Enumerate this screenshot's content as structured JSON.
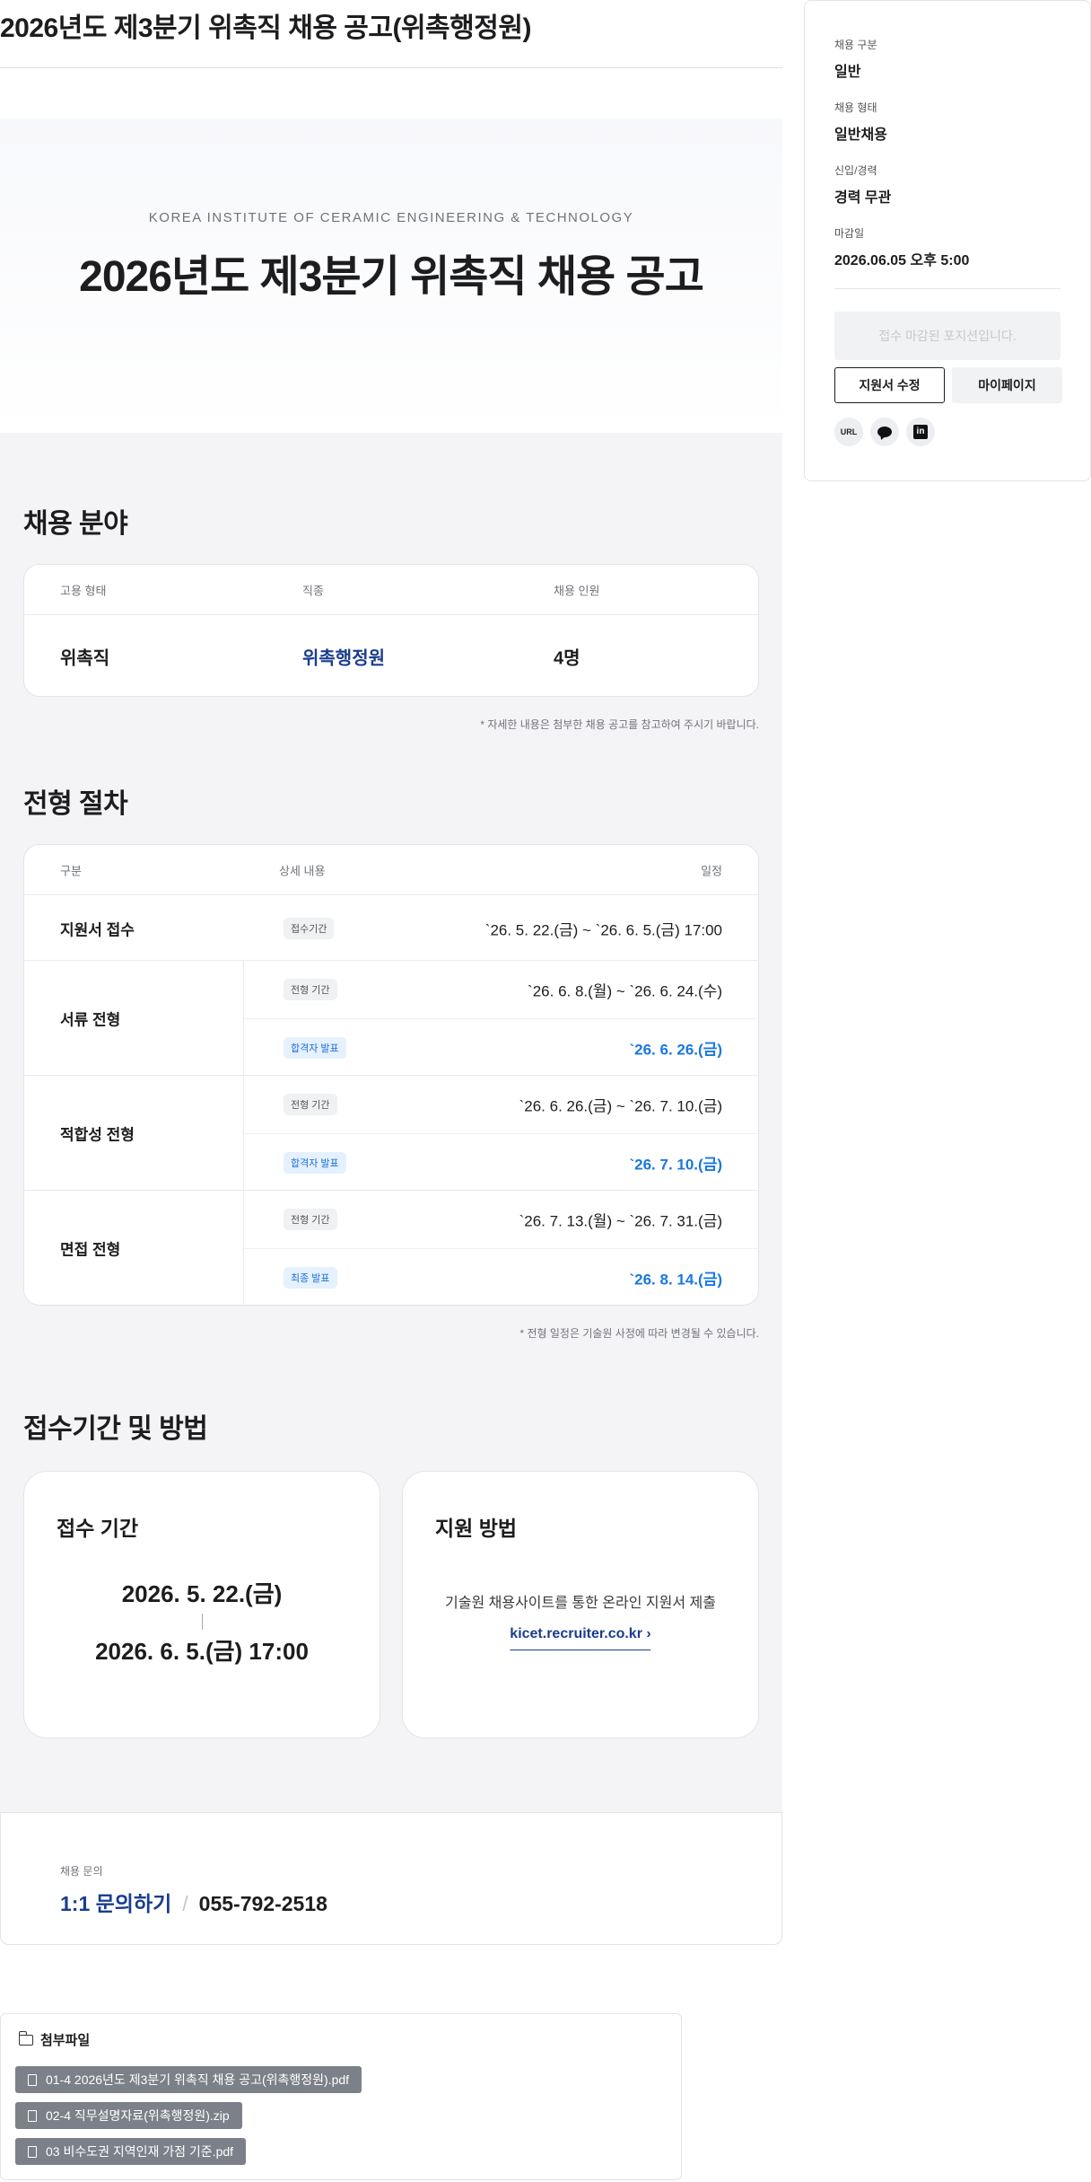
{
  "page": {
    "title": "2026년도 제3분기 위촉직 채용 공고(위촉행정원)"
  },
  "hero": {
    "subtitle": "KOREA INSTITUTE OF CERAMIC ENGINEERING & TECHNOLOGY",
    "title": "2026년도 제3분기 위촉직 채용 공고"
  },
  "recruit": {
    "section_title": "채용 분야",
    "headers": [
      "고용 형태",
      "직종",
      "채용 인원"
    ],
    "row": {
      "type": "위촉직",
      "job": "위촉행정원",
      "count": "4명"
    },
    "note": "* 자세한 내용은 첨부한 채용 공고를 참고하여 주시기 바랍니다."
  },
  "process": {
    "section_title": "전형 절차",
    "headers": [
      "구분",
      "상세 내용",
      "일정"
    ],
    "stages": [
      {
        "name": "지원서 접수",
        "items": [
          {
            "tag": "접수기간",
            "date": "`26. 5. 22.(금) ~ `26. 6. 5.(금) 17:00"
          }
        ]
      },
      {
        "name": "서류 전형",
        "items": [
          {
            "tag": "전형 기간",
            "date": "`26. 6. 8.(월) ~ `26. 6. 24.(수)"
          },
          {
            "tag": "합격자 발표",
            "date": "`26. 6. 26.(금)"
          }
        ]
      },
      {
        "name": "적합성 전형",
        "items": [
          {
            "tag": "전형 기간",
            "date": "`26. 6. 26.(금) ~ `26. 7. 10.(금)"
          },
          {
            "tag": "합격자 발표",
            "date": "`26. 7. 10.(금)"
          }
        ]
      },
      {
        "name": "면접 전형",
        "items": [
          {
            "tag": "전형 기간",
            "date": "`26. 7. 13.(월) ~ `26. 7. 31.(금)"
          },
          {
            "tag": "최종 발표",
            "date": "`26. 8. 14.(금)"
          }
        ]
      }
    ],
    "note": "* 전형 일정은 기술원 사정에 따라 변경될 수 있습니다."
  },
  "application": {
    "section_title": "접수기간 및 방법",
    "period": {
      "title": "접수 기간",
      "start": "2026. 5. 22.(금)",
      "end": "2026. 6. 5.(금) 17:00"
    },
    "method": {
      "title": "지원 방법",
      "text": "기술원 채용사이트를 통한 온라인 지원서 제출",
      "link": "kicet.recruiter.co.kr ›"
    }
  },
  "contact": {
    "label": "채용 문의",
    "link": "1:1 문의하기",
    "separator": "/",
    "phone": "055-792-2518"
  },
  "attachments": {
    "title": "첨부파일",
    "files": [
      "01-4 2026년도 제3분기 위촉직 채용 공고(위촉행정원).pdf",
      "02-4 직무설명자료(위촉행정원).zip",
      "03 비수도권 지역인재 가점 기준.pdf"
    ]
  },
  "sidebar": {
    "items": [
      {
        "label": "채용 구분",
        "value": "일반"
      },
      {
        "label": "채용 형태",
        "value": "일반채용"
      },
      {
        "label": "신입/경력",
        "value": "경력 무관"
      },
      {
        "label": "마감일",
        "value": "2026.06.05 오후 5:00"
      }
    ],
    "status": "접수 마감된 포지션입니다.",
    "edit_button": "지원서 수정",
    "mypage_button": "마이페이지",
    "share_url": "URL",
    "share_linkedin": "in"
  },
  "colors": {
    "accent_dark_blue": "#1a3d8f",
    "accent_blue": "#1b78e0",
    "bg_gray": "#f4f4f6"
  },
  "icons": [
    "folder-icon",
    "file-icon",
    "url-share-icon",
    "chat-share-icon",
    "linkedin-share-icon"
  ]
}
